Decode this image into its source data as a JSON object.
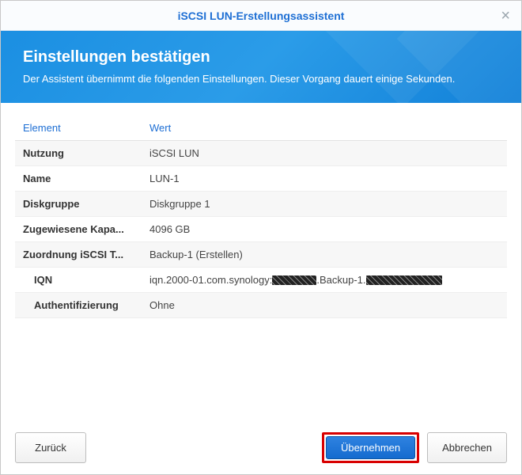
{
  "window": {
    "title": "iSCSI LUN-Erstellungsassistent"
  },
  "banner": {
    "heading": "Einstellungen bestätigen",
    "subtext": "Der Assistent übernimmt die folgenden Einstellungen. Dieser Vorgang dauert einige Sekunden."
  },
  "table": {
    "headers": {
      "key": "Element",
      "value": "Wert"
    },
    "rows": [
      {
        "key": "Nutzung",
        "value": "iSCSI LUN"
      },
      {
        "key": "Name",
        "value": "LUN-1"
      },
      {
        "key": "Diskgruppe",
        "value": "Diskgruppe 1"
      },
      {
        "key": "Zugewiesene Kapa...",
        "value": "4096 GB"
      },
      {
        "key": "Zuordnung iSCSI T...",
        "value": "Backup-1 (Erstellen)"
      },
      {
        "key": "IQN",
        "value_prefix": "iqn.2000-01.com.synology:",
        "value_mid": ".Backup-1.",
        "indent": true,
        "redacted": true
      },
      {
        "key": "Authentifizierung",
        "value": "Ohne",
        "indent": true
      }
    ]
  },
  "buttons": {
    "back": "Zurück",
    "apply": "Übernehmen",
    "cancel": "Abbrechen"
  }
}
